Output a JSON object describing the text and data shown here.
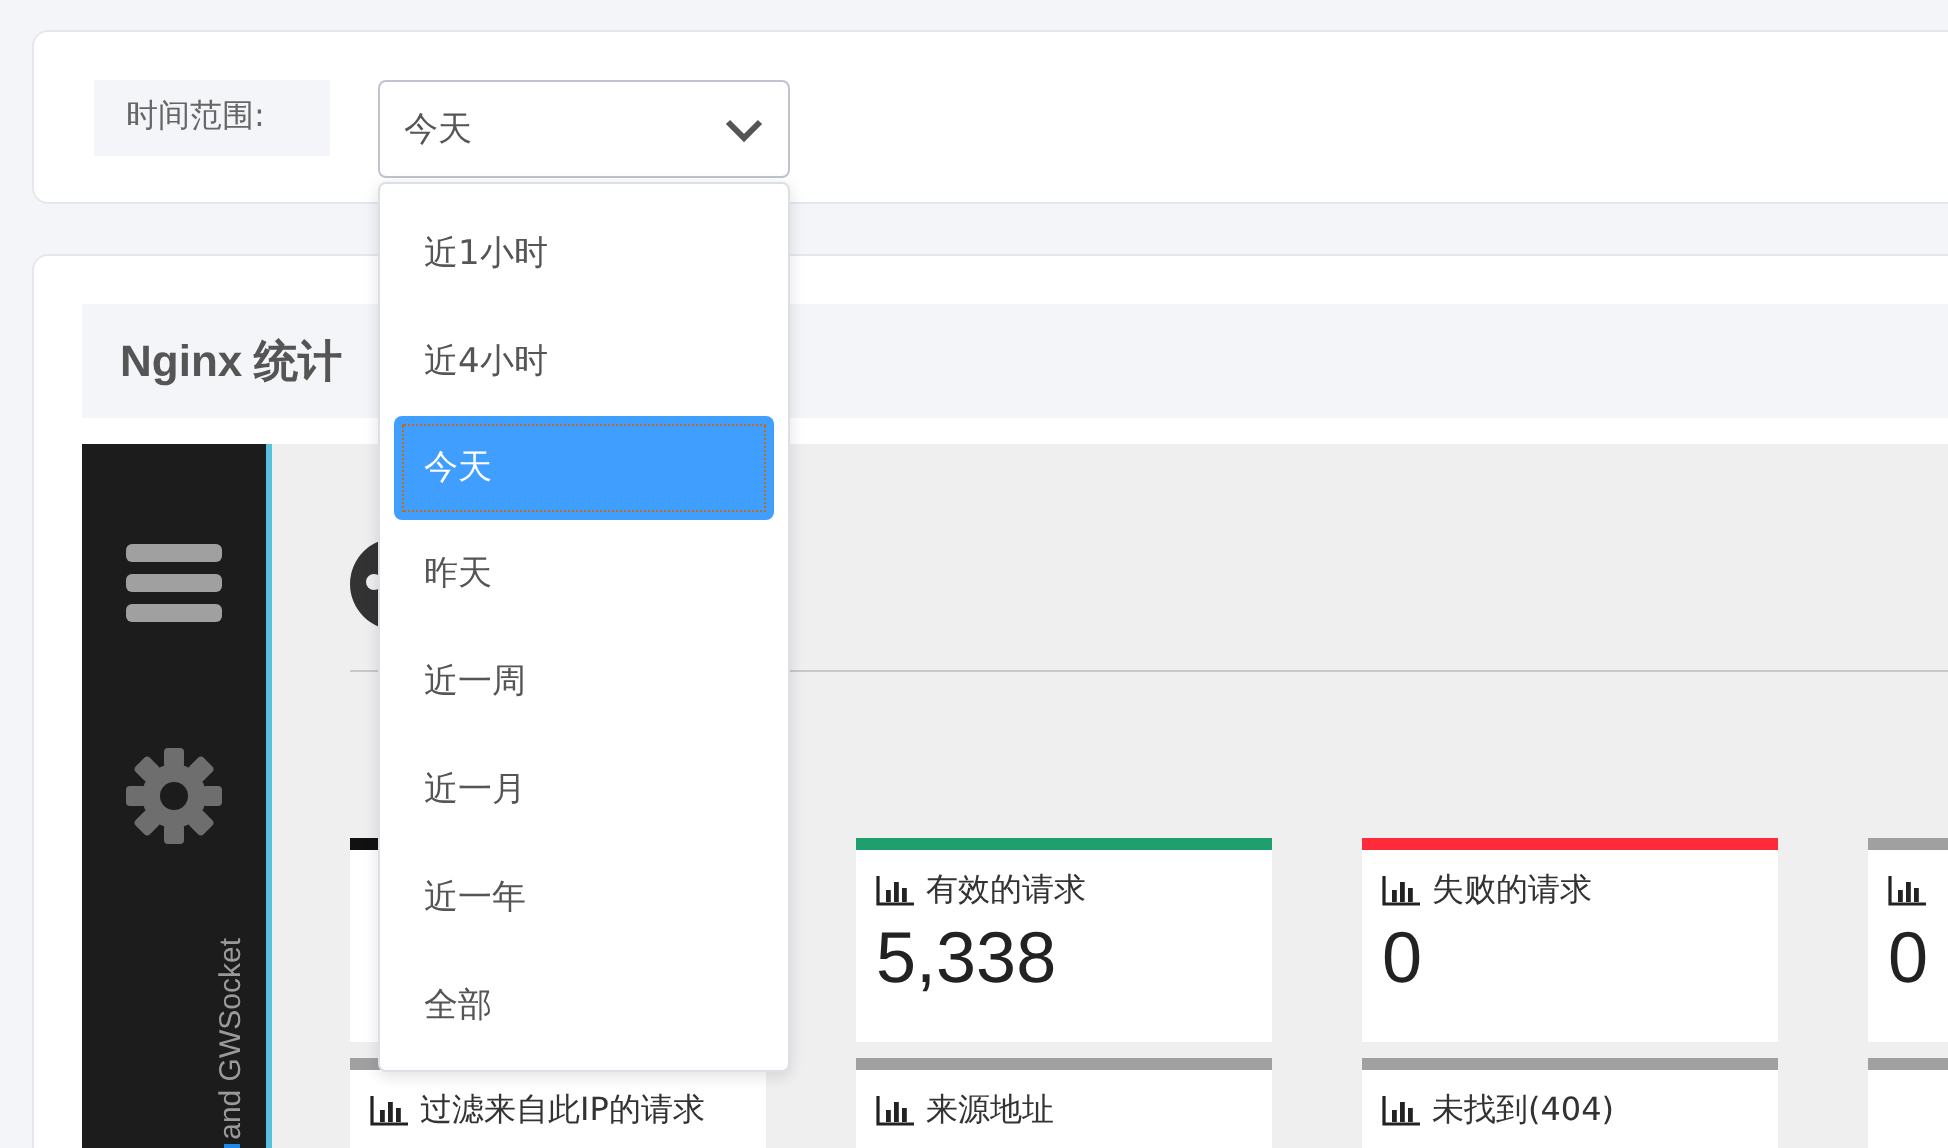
{
  "filter": {
    "label": "时间范围:",
    "select": {
      "value": "今天",
      "expanded": true
    },
    "options": [
      {
        "label": "近1小时",
        "selected": false
      },
      {
        "label": "近4小时",
        "selected": false
      },
      {
        "label": "今天",
        "selected": true
      },
      {
        "label": "昨天",
        "selected": false
      },
      {
        "label": "近一周",
        "selected": false
      },
      {
        "label": "近一月",
        "selected": false
      },
      {
        "label": "近一年",
        "selected": false
      },
      {
        "label": "全部",
        "selected": false
      }
    ]
  },
  "panel": {
    "title": "Nginx 统计",
    "sidebar": {
      "brand_text": "and GWSocket"
    },
    "stats": [
      {
        "color": "#111111"
      },
      {
        "label": "有效的请求",
        "value": "5,338",
        "color": "#1f9e6e"
      },
      {
        "label": "失败的请求",
        "value": "0",
        "color": "#ff2b3a"
      },
      {
        "value": "0",
        "color": "#a0a0a0"
      },
      {
        "label": "过滤来自此IP的请求",
        "color": "#a0a0a0"
      },
      {
        "label": "来源地址",
        "color": "#a0a0a0"
      },
      {
        "label": "未找到(404)",
        "color": "#a0a0a0"
      },
      {
        "color": "#a0a0a0"
      }
    ]
  }
}
